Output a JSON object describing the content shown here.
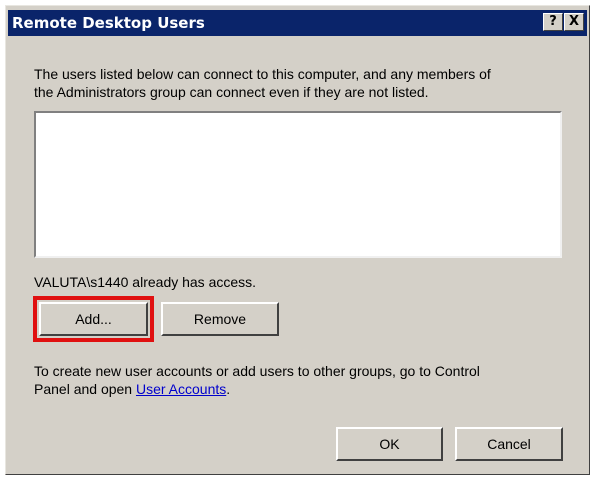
{
  "dialog": {
    "title": "Remote Desktop Users",
    "help_button": "?",
    "close_button": "X",
    "intro_line1": "The users listed below can connect to this computer, and any members of",
    "intro_line2": "the Administrators group can connect even if they are not listed.",
    "users": [],
    "access_status": "VALUTA\\s1440 already has access.",
    "add_button": "Add...",
    "remove_button": "Remove",
    "info_line1": "To create new user accounts or add users to other groups, go to Control",
    "info_line2_prefix": "Panel and open ",
    "info_link": "User Accounts",
    "info_line2_suffix": ".",
    "ok_button": "OK",
    "cancel_button": "Cancel"
  },
  "colors": {
    "titlebar": "#0a246a",
    "dialog_bg": "#d4d0c8",
    "highlight": "#e01010",
    "link": "#0000cc"
  }
}
